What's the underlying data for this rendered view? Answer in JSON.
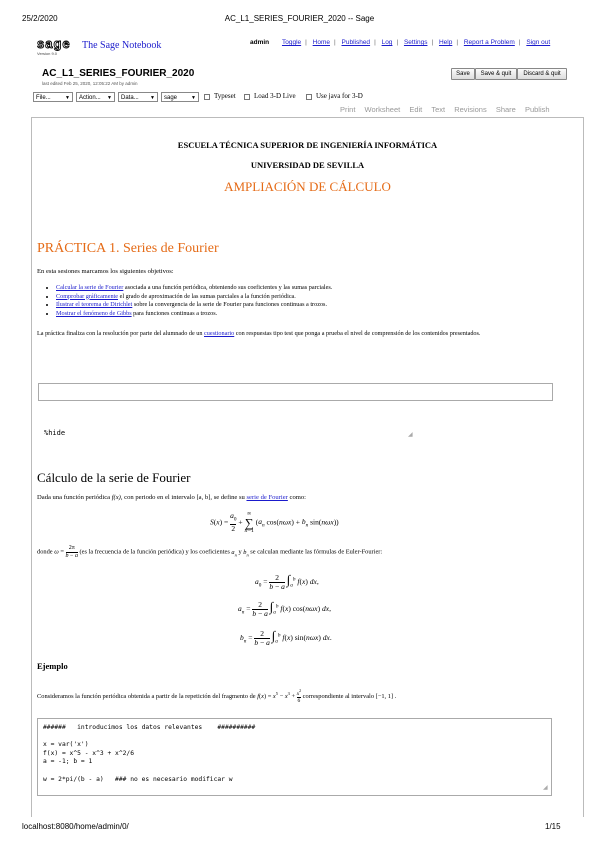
{
  "print": {
    "date": "25/2/2020",
    "title": "AC_L1_SERIES_FOURIER_2020 -- Sage",
    "url": "localhost:8080/home/admin/0/",
    "page": "1/15"
  },
  "topbar": {
    "logo_text": "sage",
    "version": "Version 9.0",
    "app_name": "The Sage Notebook",
    "user": "admin",
    "links": [
      "Toggle",
      "Home",
      "Published",
      "Log",
      "Settings",
      "Help",
      "Report a Problem",
      "Sign out"
    ]
  },
  "worksheet": {
    "title": "AC_L1_SERIES_FOURIER_2020",
    "last_edited": "last edited Feb 25, 2020, 12:05:22 AM by admin",
    "buttons": [
      "Save",
      "Save & quit",
      "Discard & quit"
    ],
    "selects": [
      "File...",
      "Action...",
      "Data...",
      "sage"
    ],
    "checkboxes": [
      "Typeset",
      "Load 3-D Live",
      "Use java for 3-D"
    ],
    "tabs": [
      "Print",
      "Worksheet",
      "Edit",
      "Text",
      "Revisions",
      "Share",
      "Publish"
    ]
  },
  "doc": {
    "school": "ESCUELA TÉCNICA SUPERIOR DE INGENIERÍA INFORMÁTICA",
    "university": "UNIVERSIDAD DE SEVILLA",
    "course": "AMPLIACIÓN DE CÁLCULO",
    "practice_title": "PRÁCTICA 1. Series de Fourier",
    "objectives_intro": "En esta sesiones marcamos los siguientes objetivos:",
    "objectives": [
      {
        "link": "Calcular la serie de Fourier",
        "rest": " asociada a una función periódica, obteniendo sus coeficientes y las sumas parciales."
      },
      {
        "link": "Comprobar gráficamente",
        "rest": " el grado de aproximación de las sumas parciales a la función periódica."
      },
      {
        "link": "Ilustrar el teorema de Dirichlet",
        "rest": " sobre la convergencia de la serie de Fourier para funciones continuas a trozos."
      },
      {
        "link": "Mostrar el fenómeno de Gibbs",
        "rest": " para funciones continuas a trozos."
      }
    ],
    "final_note_pre": "La práctica finaliza con la resolución por parte del alumnado de un ",
    "final_note_link": "cuestionario",
    "final_note_post": " con respuestas tipo test que ponga a prueba el nivel de comprensión de los contenidos presentados.",
    "hide_cell": "%hide",
    "section_title": "Cálculo de la serie de Fourier",
    "p1_pre": "Dada una función periódica ",
    "p1_fx": "f(x)",
    "p1_mid": ", con periodo en el intervalo ",
    "p1_int": "[a, b]",
    "p1_mid2": ", se define su ",
    "p1_link": "serie de Fourier",
    "p1_post": " como:",
    "donde_pre": "donde ",
    "donde_post": " (es la frecuencia de la función periódica) y los coeficientes ",
    "donde_post2": " se calculan mediante las fórmulas de Euler-Fourier:",
    "ejemplo": "Ejemplo",
    "consider_pre": "Consideramos la función periódica obtenida a partir de la repetición del fragmento de ",
    "consider_post": " correspondiente al intervalo ",
    "consider_int": "[−1, 1]",
    "code_lines": [
      "######   introducimos los datos relevantes    ##########",
      "",
      "x = var('x')",
      "f(x) = x^5 - x^3 + x^2/6",
      "a = -1; b = 1",
      "",
      "w = 2*pi/(b - a)   ### no es necesario modificar w"
    ]
  },
  "colors": {
    "accent": "#e56b17",
    "link": "#1a1acc"
  }
}
